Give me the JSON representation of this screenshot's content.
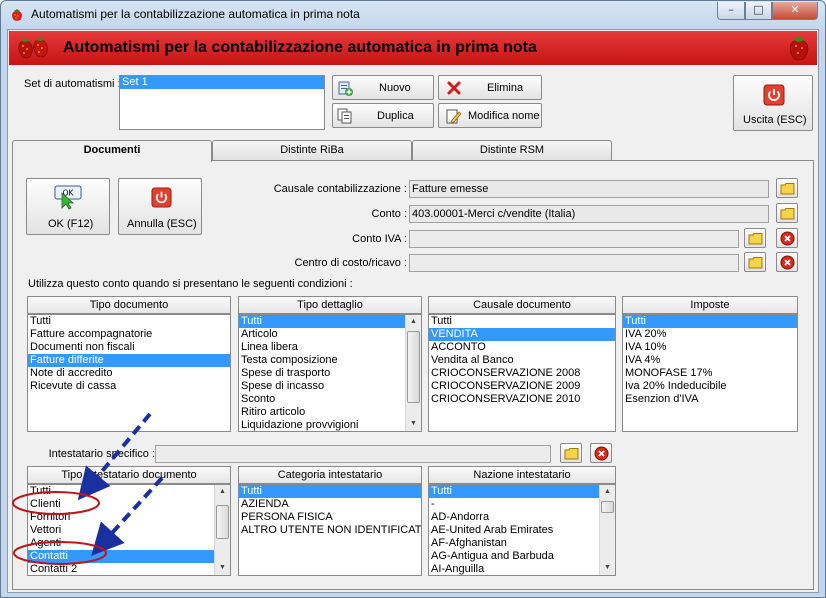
{
  "window": {
    "title": "Automatismi per la contabilizzazione automatica in prima nota",
    "controls": {
      "minimize": "–",
      "maximize": "□",
      "close": "✕"
    }
  },
  "header": {
    "title": "Automatismi per la contabilizzazione automatica in prima nota",
    "accent_color": "#d41c1c"
  },
  "set": {
    "label": "Set di automatismi :",
    "items": [
      {
        "text": "Set 1",
        "selected": true
      }
    ]
  },
  "toolbar": {
    "nuovo": "Nuovo",
    "elimina": "Elimina",
    "duplica": "Duplica",
    "modifica_nome": "Modifica nome",
    "uscita": "Uscita (ESC)"
  },
  "tabs": [
    {
      "label": "Documenti",
      "active": true
    },
    {
      "label": "Distinte RiBa",
      "active": false
    },
    {
      "label": "Distinte RSM",
      "active": false
    }
  ],
  "actions": {
    "ok": "OK (F12)",
    "ok_icon_text": "OK",
    "annulla": "Annulla (ESC)"
  },
  "form": {
    "causale_label": "Causale contabilizzazione :",
    "causale_value": "Fatture emesse",
    "conto_label": "Conto :",
    "conto_value": "403.00001-Merci c/vendite (Italia)",
    "conto_iva_label": "Conto IVA :",
    "conto_iva_value": "",
    "centro_label": "Centro di costo/ricavo :",
    "centro_value": ""
  },
  "conditions_label": "Utilizza questo conto quando si presentano le seguenti condizioni :",
  "lists": {
    "tipo_documento": {
      "header": "Tipo documento",
      "items": [
        "Tutti",
        "Fatture accompagnatorie",
        "Documenti non fiscali",
        "Fatture differite",
        "Note di accredito",
        "Ricevute di cassa"
      ],
      "selected": [
        3
      ]
    },
    "tipo_dettaglio": {
      "header": "Tipo dettaglio",
      "items": [
        "Tutti",
        "Articolo",
        "Linea libera",
        "Testa composizione",
        "Spese di trasporto",
        "Spese di incasso",
        "Sconto",
        "Ritiro articolo",
        "Liquidazione provvigioni"
      ],
      "selected": [
        0
      ]
    },
    "causale_documento": {
      "header": "Causale documento",
      "items": [
        "Tutti",
        "VENDITA",
        "ACCONTO",
        "Vendita al Banco",
        "CRIOCONSERVAZIONE 2008",
        "CRIOCONSERVAZIONE 2009",
        "CRIOCONSERVAZIONE 2010"
      ],
      "selected": [
        1
      ]
    },
    "imposte": {
      "header": "Imposte",
      "items": [
        "Tutti",
        "IVA 20%",
        "IVA 10%",
        "IVA 4%",
        "MONOFASE 17%",
        "Iva 20% Indeducibile",
        "Esenzion d'IVA"
      ],
      "selected": [
        0
      ]
    },
    "tipo_intestatario": {
      "header": "Tipo intestatario documento",
      "items": [
        "Tutti",
        "Clienti",
        "Fornitori",
        "Vettori",
        "Agenti",
        "Contatti",
        "Contatti 2"
      ],
      "selected": [
        5
      ]
    },
    "categoria_intestatario": {
      "header": "Categoria intestatario",
      "items": [
        "Tutti",
        "AZIENDA",
        "PERSONA FISICA",
        "ALTRO UTENTE NON IDENTIFICAT"
      ],
      "selected": [
        0
      ]
    },
    "nazione_intestatario": {
      "header": "Nazione intestatario",
      "items": [
        "Tutti",
        "-",
        "AD-Andorra",
        "AE-United Arab Emirates",
        "AF-Afghanistan",
        "AG-Antigua and Barbuda",
        "AI-Anguilla"
      ],
      "selected": [
        0
      ]
    }
  },
  "intestatario": {
    "label": "Intestatario specifico :",
    "value": ""
  },
  "colors": {
    "selection": "#3399ff",
    "annotation_arrow": "#1a2fa0",
    "annotation_ellipse": "#c0141c"
  }
}
